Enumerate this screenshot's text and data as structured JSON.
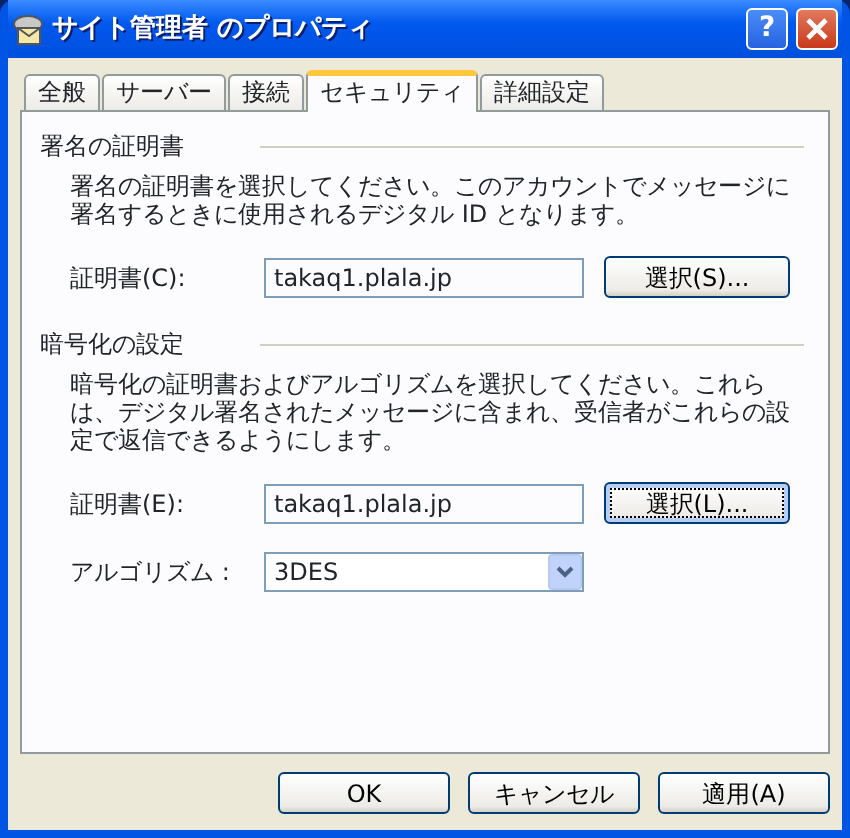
{
  "window": {
    "title": "サイト管理者 のプロパティ",
    "help": "?"
  },
  "tabs": [
    {
      "label": "全般",
      "selected": false
    },
    {
      "label": "サーバー",
      "selected": false
    },
    {
      "label": "接続",
      "selected": false
    },
    {
      "label": "セキュリティ",
      "selected": true
    },
    {
      "label": "詳細設定",
      "selected": false
    }
  ],
  "sections": [
    {
      "heading": "署名の証明書",
      "description": "署名の証明書を選択してください。このアカウントでメッセージに署名するときに使用されるデジタル ID となります。",
      "rows": [
        {
          "kind": "field",
          "label": "証明書(C):",
          "value": "takaq1.plala.jp",
          "button": {
            "label": "選択(S)...",
            "focused": false
          }
        }
      ]
    },
    {
      "heading": "暗号化の設定",
      "description": "暗号化の証明書およびアルゴリズムを選択してください。これらは、デジタル署名されたメッセージに含まれ、受信者がこれらの設定で返信できるようにします。",
      "rows": [
        {
          "kind": "field",
          "label": "証明書(E):",
          "value": "takaq1.plala.jp",
          "button": {
            "label": "選択(L)...",
            "focused": true
          }
        },
        {
          "kind": "select",
          "label": "アルゴリズム :",
          "value": "3DES"
        }
      ]
    }
  ],
  "buttons": [
    "OK",
    "キャンセル",
    "適用(A)"
  ]
}
